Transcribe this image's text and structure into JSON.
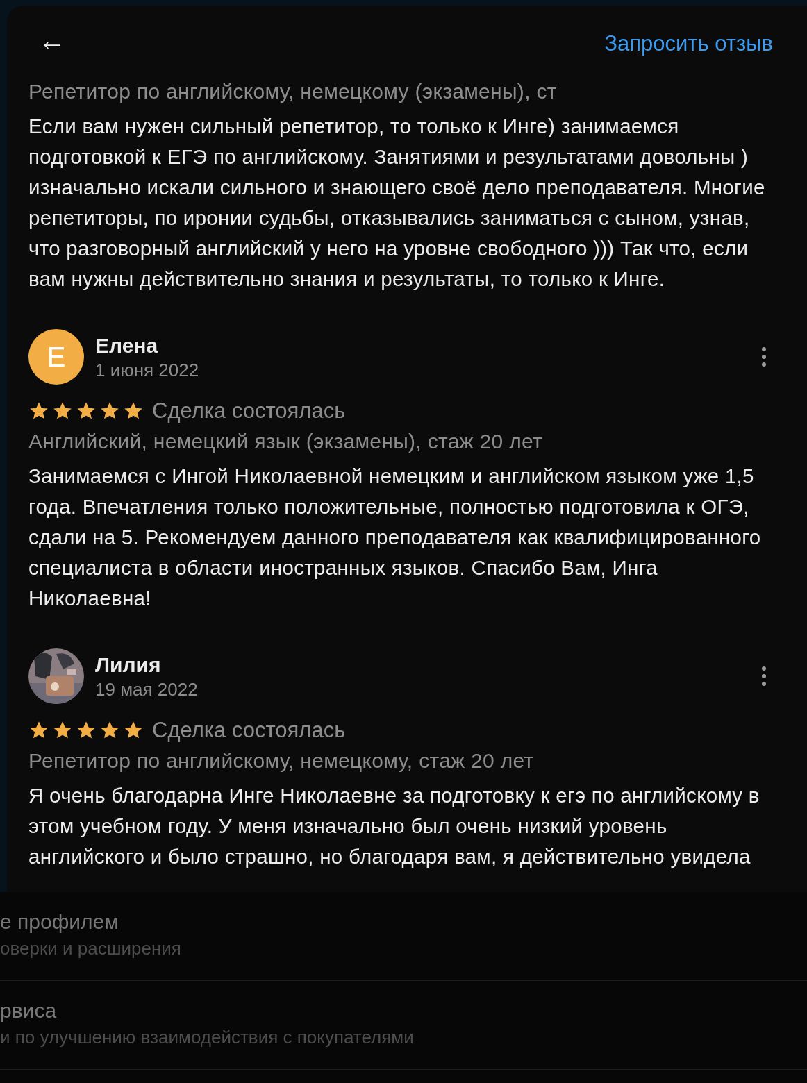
{
  "header": {
    "back_label": "←",
    "action": "Запросить отзыв"
  },
  "reviews": [
    {
      "meta": "Репетитор по английскому, немецкому (экзамены), ст",
      "text": "Если вам нужен сильный репетитор, то только к Инге) занимаемся подготовкой к ЕГЭ по английскому. Занятиями и результатами довольны ) изначально искали сильного и знающего своё дело преподавателя. Многие репетиторы, по иронии судьбы, отказывались заниматься с сыном, узнав, что разговорный английский у него на уровне свободного ))) Так что, если вам нужны действительно знания и результаты, то только к Инге."
    },
    {
      "author": "Елена",
      "date": "1 июня 2022",
      "avatar": {
        "kind": "letter",
        "letter": "Е",
        "color": "#f2ae45"
      },
      "stars": 5,
      "status": "Сделка состоялась",
      "meta": "Английский, немецкий язык (экзамены), стаж 20 лет",
      "text": "Занимаемся с Ингой Николаевной немецким и английском языком уже 1,5 года. Впечатления только положительные, полностью подготовила к ОГЭ, сдали на 5. Рекомендуем данного преподавателя как квалифицированного специалиста в области иностранных языков. Спасибо Вам, Инга Николаевна!"
    },
    {
      "author": "Лилия",
      "date": "19 мая 2022",
      "stars": 5,
      "status": "Сделка состоялась",
      "meta": "Репетитор по английскому, немецкому, стаж 20 лет",
      "text": "Я очень благодарна Инге Николаевне за подготовку к егэ по английскому в этом учебном году. У меня изначально был очень низкий уровень английского и было страшно, но благодаря вам, я действительно увидела"
    }
  ],
  "background_sheet": [
    {
      "title": "е профилем",
      "subtitle": "оверки и расширения"
    },
    {
      "title": "рвиса",
      "subtitle": "и по улучшению взаимодействия с покупателями"
    }
  ]
}
